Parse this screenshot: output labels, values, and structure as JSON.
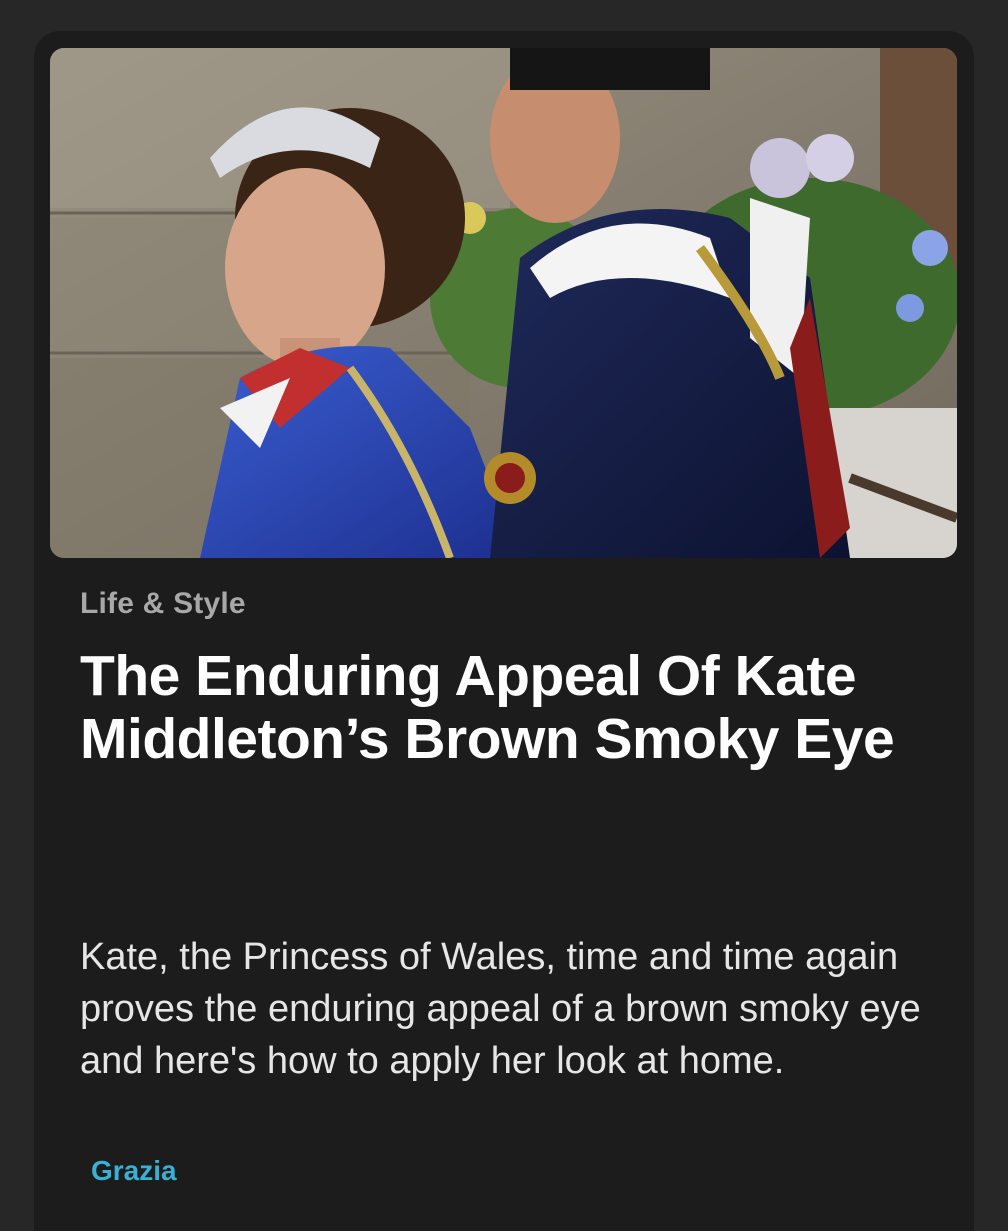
{
  "article": {
    "category": "Life & Style",
    "headline": "The Enduring Appeal Of Kate Middleton’s Brown Smoky Eye",
    "summary": "Kate, the Princess of Wales, time and time again proves the enduring appeal of a brown smoky eye and here's how to apply her look at home.",
    "source": "Grazia"
  },
  "colors": {
    "page_bg": "#272727",
    "card_bg": "#1c1c1c",
    "category_text": "#a8a8a8",
    "headline_text": "#ffffff",
    "summary_text": "#e6e6e6",
    "source_text": "#3ab0d4"
  }
}
